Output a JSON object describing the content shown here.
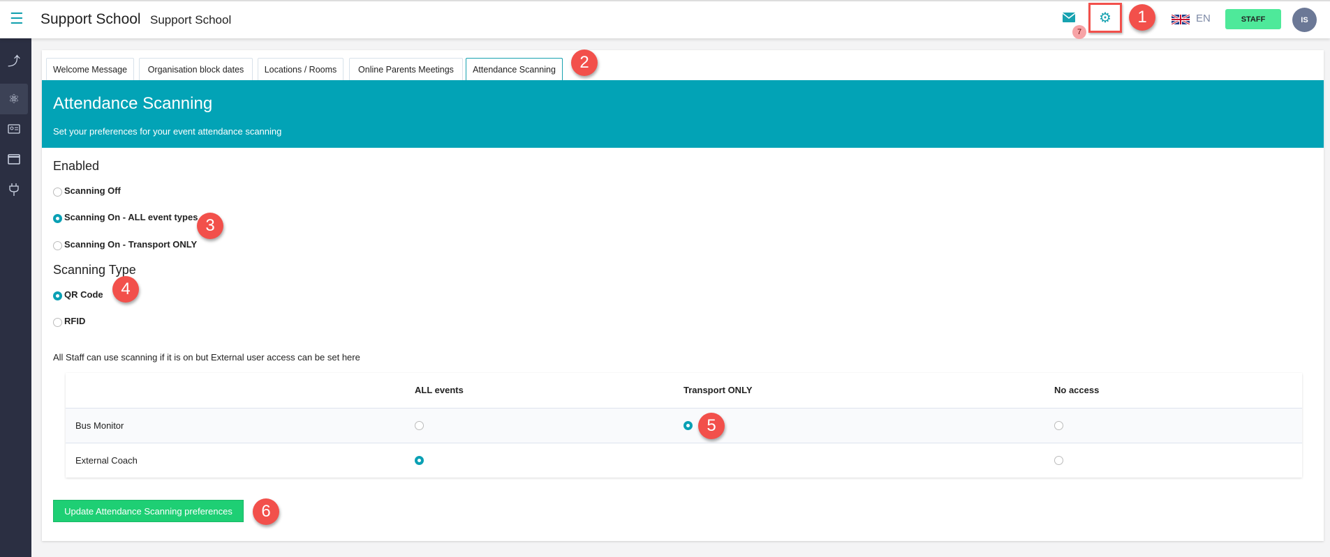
{
  "header": {
    "title": "Support School",
    "subtitle": "Support School",
    "mail_badge": "7",
    "language": "EN",
    "role_button": "STAFF",
    "avatar_initials": "IS"
  },
  "tabs": [
    {
      "label": "Welcome Message"
    },
    {
      "label": "Organisation block dates"
    },
    {
      "label": "Locations / Rooms"
    },
    {
      "label": "Online Parents Meetings"
    },
    {
      "label": "Attendance Scanning",
      "active": true
    }
  ],
  "banner": {
    "title": "Attendance Scanning",
    "subtitle": "Set your preferences for your event attendance scanning"
  },
  "enabled": {
    "heading": "Enabled",
    "options": [
      {
        "label": "Scanning Off",
        "selected": false
      },
      {
        "label": "Scanning On - ALL event types",
        "selected": true
      },
      {
        "label": "Scanning On - Transport ONLY",
        "selected": false
      }
    ]
  },
  "scanning_type": {
    "heading": "Scanning Type",
    "options": [
      {
        "label": "QR Code",
        "selected": true
      },
      {
        "label": "RFID",
        "selected": false
      }
    ]
  },
  "access_note": "All Staff can use scanning if it is on but External user access can be set here",
  "access_table": {
    "columns": [
      "ALL events",
      "Transport ONLY",
      "No access"
    ],
    "rows": [
      {
        "label": "Bus Monitor",
        "selected": "Transport ONLY"
      },
      {
        "label": "External Coach",
        "selected": "ALL events"
      }
    ]
  },
  "submit_label": "Update Attendance Scanning preferences",
  "annotations": [
    "1",
    "2",
    "3",
    "4",
    "5",
    "6"
  ],
  "colors": {
    "accent": "#02a3b6",
    "button_green": "#1ecf74",
    "staff_green": "#4ee99a",
    "annotation_red": "#f2504b",
    "sidebar": "#2b2f42"
  }
}
